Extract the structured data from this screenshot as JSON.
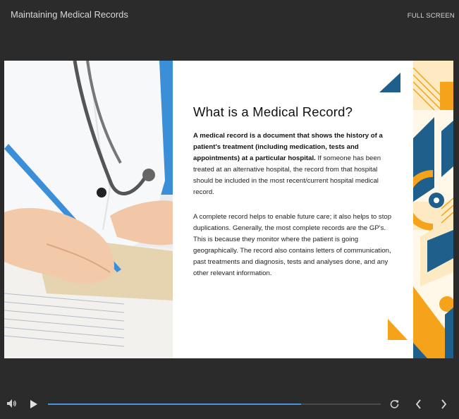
{
  "header": {
    "title": "Maintaining Medical Records",
    "fullscreen_label": "FULL SCREEN"
  },
  "slide": {
    "heading": "What is a Medical Record?",
    "paragraph1_bold": "A medical record is a document that shows the history of a patient's treatment (including medication, tests and appointments) at a particular hospital.",
    "paragraph1_rest": " If someone has been treated at an alternative hospital, the record from that hospital should be included in the most recent/current hospital medical record.",
    "paragraph2": "A complete record helps to enable future care; it also helps to stop duplications. Generally, the most complete records are the GP's. This is because they monitor where the patient is going geographically. The record also contains letters of communication, past treatments and diagnosis, tests and analyses done, and any other relevant information."
  },
  "player": {
    "progress": 0.76,
    "icons": {
      "volume": "volume-icon",
      "play": "play-icon",
      "replay": "replay-icon",
      "prev": "chevron-left-icon",
      "next": "chevron-right-icon"
    }
  },
  "colors": {
    "background": "#2b2b2b",
    "accent_blue": "#1f5f8b",
    "accent_orange": "#f5a31a",
    "accent_cream": "#fde9c2",
    "progress": "#4a90e2"
  }
}
